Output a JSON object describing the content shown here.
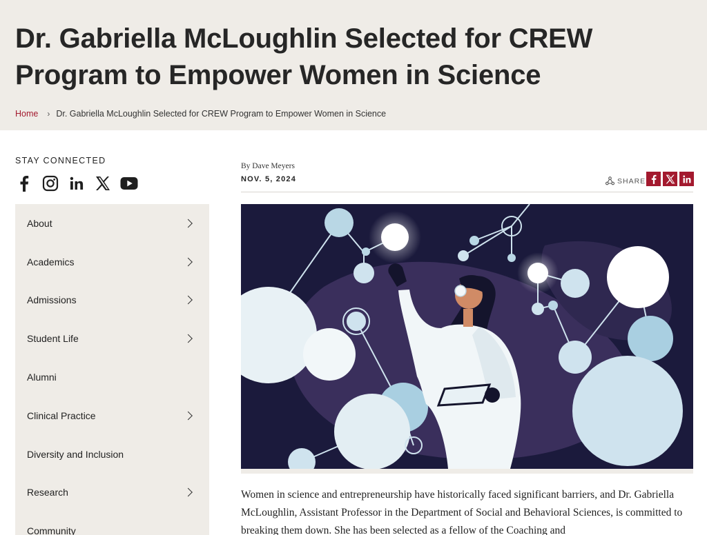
{
  "header": {
    "title": "Dr. Gabriella McLoughlin Selected for CREW Program to Empower Women in Science",
    "breadcrumb": {
      "home": "Home",
      "separator": "›",
      "current": "Dr. Gabriella McLoughlin Selected for CREW Program to Empower Women in Science"
    }
  },
  "sidebar": {
    "stay_connected": "STAY CONNECTED",
    "social_icons": [
      "facebook-icon",
      "instagram-icon",
      "linkedin-icon",
      "x-icon",
      "youtube-icon"
    ],
    "nav": [
      {
        "label": "About",
        "has_children": true
      },
      {
        "label": "Academics",
        "has_children": true
      },
      {
        "label": "Admissions",
        "has_children": true
      },
      {
        "label": "Student Life",
        "has_children": true
      },
      {
        "label": "Alumni",
        "has_children": false
      },
      {
        "label": "Clinical Practice",
        "has_children": true
      },
      {
        "label": "Diversity and Inclusion",
        "has_children": false
      },
      {
        "label": "Research",
        "has_children": true
      },
      {
        "label": "Community",
        "has_children": false
      }
    ]
  },
  "article": {
    "byline": "By Dave Meyers",
    "date": "NOV. 5, 2024",
    "share_label": "SHARE",
    "share_buttons": [
      "facebook-icon",
      "x-icon",
      "linkedin-icon"
    ],
    "body_text": "Women in science and entrepreneurship have historically faced significant barriers, and Dr. Gabriella McLoughlin, Assistant Professor in the Department of Social and Behavioral Sciences, is committed to breaking them down. She has been selected as a fellow of the Coaching and"
  },
  "colors": {
    "accent": "#a3192e",
    "panel": "#efece7",
    "art_bg": "#3a2f5c"
  }
}
